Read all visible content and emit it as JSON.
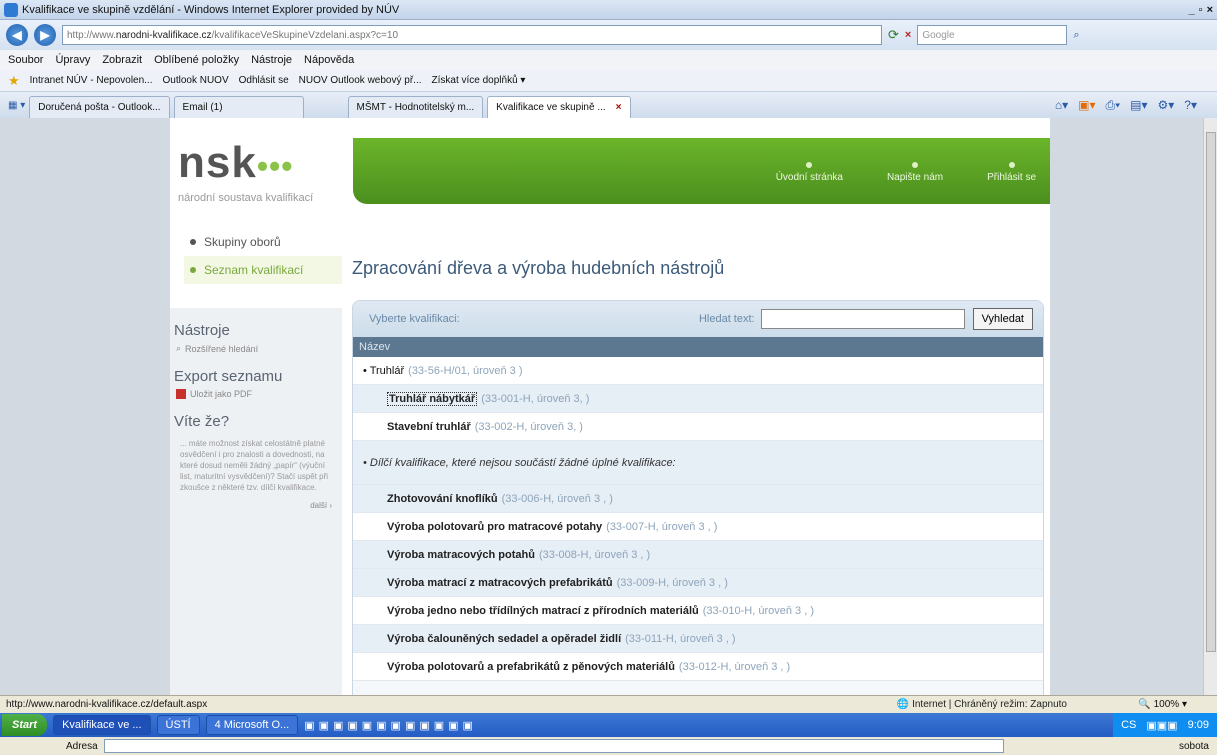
{
  "window": {
    "title": "Kvalifikace ve skupině vzdělání - Windows Internet Explorer provided by NÚV"
  },
  "addressbar": {
    "url_prefix": "http://www.",
    "url_domain": "narodni-kvalifikace.cz",
    "url_rest": "/kvalifikaceVeSkupineVzdelani.aspx?c=10",
    "search_placeholder": "Google"
  },
  "menu": [
    "Soubor",
    "Úpravy",
    "Zobrazit",
    "Oblíbené položky",
    "Nástroje",
    "Nápověda"
  ],
  "favorites": [
    "Intranet NÚV - Nepovolen...",
    "Outlook NUOV",
    "Odhlásit se",
    "NUOV Outlook webový př...",
    "Získat více doplňků ▾"
  ],
  "tabs": [
    "Doručená pošta - Outlook...",
    "Email (1)",
    "MŠMT - Hodnotitelský m...",
    "Kvalifikace ve skupině ..."
  ],
  "site": {
    "logo": "nsk",
    "logo_sub": "národní soustava kvalifikací",
    "topnav": [
      "Úvodní stránka",
      "Napište nám",
      "Přihlásit se"
    ],
    "sidenav": [
      "Skupiny oborů",
      "Seznam kvalifikací"
    ],
    "tools_heading": "Nástroje",
    "tools_link": "Rozšířené hledání",
    "export_heading": "Export seznamu",
    "export_link": "Uložit jako PDF",
    "vite_heading": "Víte že?",
    "vite_text": "... máte možnost získat celostátně platné osvědčení i pro znalosti a dovednosti, na které dosud neměli žádný „papír“ (výuční list, maturitní vysvědčení)? Stačí uspět při zkoušce z některé tzv. dílčí kvalifikace.",
    "vite_more": "další ›",
    "page_title": "Zpracování dřeva a výroba hudebních nástrojů",
    "select_label": "Vyberte kvalifikaci:",
    "search_label": "Hledat text:",
    "search_button": "Vyhledat",
    "column_header": "Název"
  },
  "rows": [
    {
      "type": "group",
      "name": "• Truhlář",
      "meta": "(33-56-H/01, úroveň 3 )"
    },
    {
      "type": "item",
      "name": "Truhlář nábytkář",
      "meta": "(33-001-H, úroveň 3,  )",
      "shade": true,
      "focus": true
    },
    {
      "type": "item",
      "name": "Stavební truhlář",
      "meta": "(33-002-H, úroveň 3,  )"
    },
    {
      "type": "note",
      "name": "• Dílčí kvalifikace, které nejsou součástí žádné úplné kvalifikace:",
      "meta": "",
      "shade": true
    },
    {
      "type": "item",
      "name": "Zhotovování knoflíků",
      "meta": "(33-006-H, úroveň 3 ,  )",
      "shade": true
    },
    {
      "type": "item",
      "name": "Výroba polotovarů pro matracové potahy",
      "meta": "(33-007-H, úroveň 3 ,  )"
    },
    {
      "type": "item",
      "name": "Výroba matracových potahů",
      "meta": "(33-008-H, úroveň 3 ,  )",
      "shade": true
    },
    {
      "type": "item",
      "name": "Výroba matrací z matracových prefabrikátů",
      "meta": "(33-009-H, úroveň 3 ,  )",
      "shade": true
    },
    {
      "type": "item",
      "name": "Výroba jedno nebo třídílných matrací z přírodních materiálů",
      "meta": "(33-010-H, úroveň 3 ,  )"
    },
    {
      "type": "item",
      "name": "Výroba čalouněných sedadel a opěradel židlí",
      "meta": "(33-011-H, úroveň 3 ,  )",
      "shade": true
    },
    {
      "type": "item",
      "name": "Výroba polotovarů a prefabrikátů z pěnových materiálů",
      "meta": "(33-012-H, úroveň 3 ,  )"
    }
  ],
  "status": {
    "url": "http://www.narodni-kvalifikace.cz/default.aspx",
    "zone": "Internet | Chráněný režim: Zapnuto",
    "zoom": "100%"
  },
  "taskbar": {
    "start": "Start",
    "buttons": [
      "Kvalifikace ve ...",
      "ÚSTÍ",
      "4 Microsoft O..."
    ],
    "lang": "CS",
    "time": "9:09",
    "day": "sobota",
    "address_label": "Adresa"
  }
}
